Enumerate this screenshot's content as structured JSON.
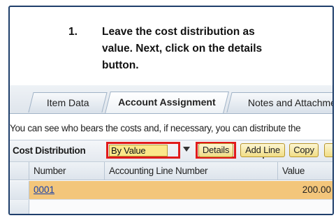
{
  "instruction": {
    "number": "1.",
    "text": "Leave the cost distribution as value. Next, click on the details button."
  },
  "tabs": [
    {
      "label": "Item Data",
      "active": false
    },
    {
      "label": "Account Assignment",
      "active": true
    },
    {
      "label": "Notes and Attachme",
      "active": false
    }
  ],
  "info_text": "You can see who bears the costs and, if necessary, you can distribute the",
  "toolbar": {
    "cost_distribution_label": "Cost Distribution",
    "cost_distribution_value": "By Value",
    "details_label": "Details",
    "add_line_label": "Add Line",
    "copy_label": "Copy"
  },
  "table": {
    "headers": [
      "Number",
      "Accounting Line Number",
      "Value"
    ],
    "rows": [
      {
        "number": "0001",
        "accounting_line_number": "",
        "value": "200.00"
      }
    ]
  },
  "colors": {
    "highlight_red": "#e11b1b",
    "frame_border": "#1f3f6b",
    "row_selected": "#f3c67b",
    "button_yellow": "#f1dd86"
  }
}
